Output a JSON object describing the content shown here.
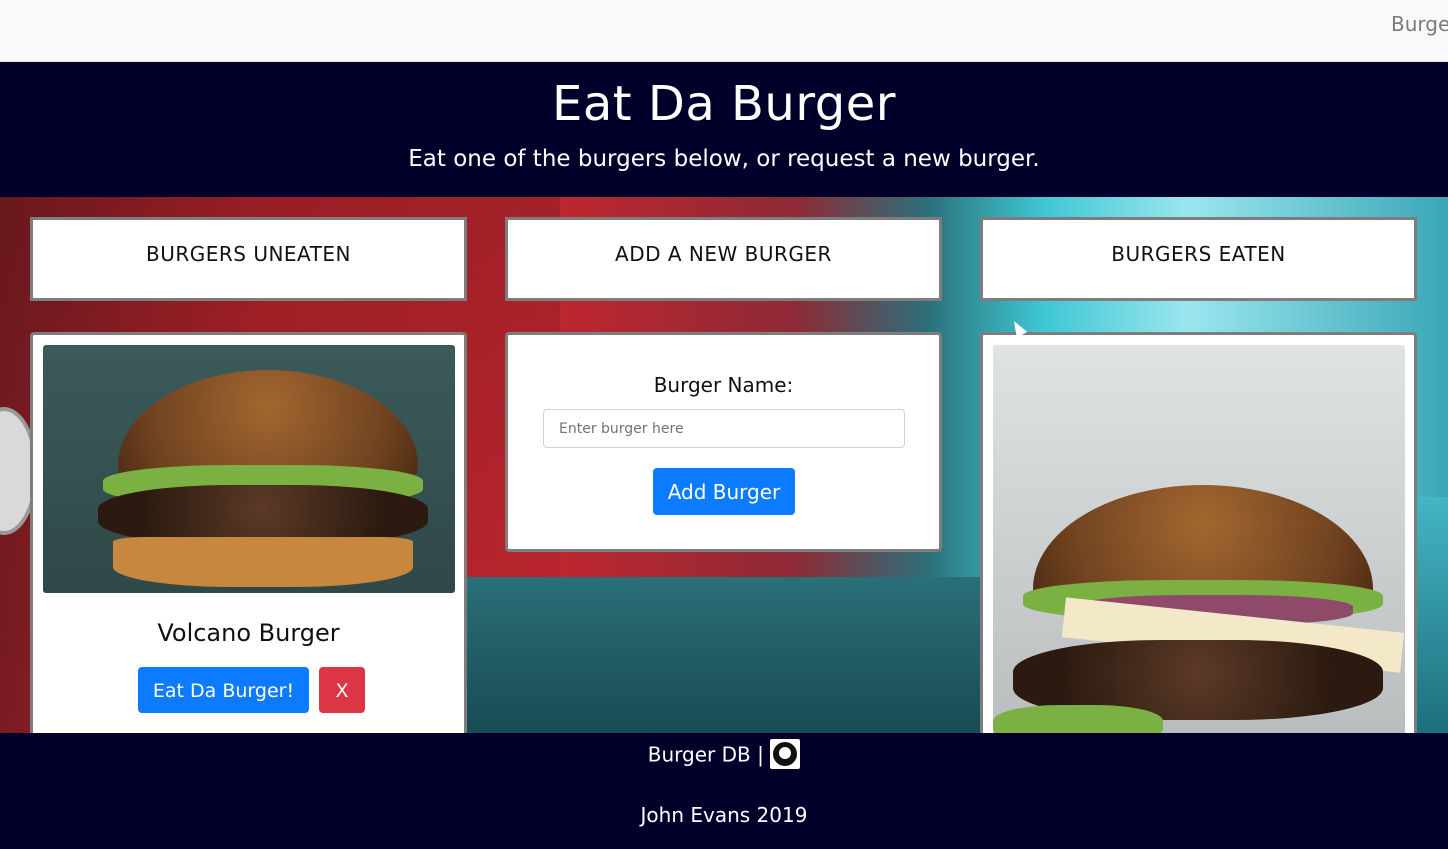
{
  "nav": {
    "brand": "Burge"
  },
  "hero": {
    "title": "Eat Da Burger",
    "subtitle": "Eat one of the burgers below, or request a new burger."
  },
  "columns": {
    "uneaten_header": "BURGERS UNEATEN",
    "add_header": "ADD A NEW BURGER",
    "eaten_header": "BURGERS EATEN"
  },
  "uneaten": [
    {
      "name": "Volcano Burger",
      "eat_label": "Eat Da Burger!",
      "delete_label": "X"
    }
  ],
  "form": {
    "label": "Burger Name:",
    "placeholder": "Enter burger here",
    "value": "",
    "submit_label": "Add Burger"
  },
  "footer": {
    "link_text": "Burger DB |",
    "credit": "John Evans 2019"
  },
  "colors": {
    "hero_bg": "#02002a",
    "primary": "#0d7bff",
    "danger": "#dc3545"
  },
  "icons": {
    "footer_icon": "github-icon"
  }
}
